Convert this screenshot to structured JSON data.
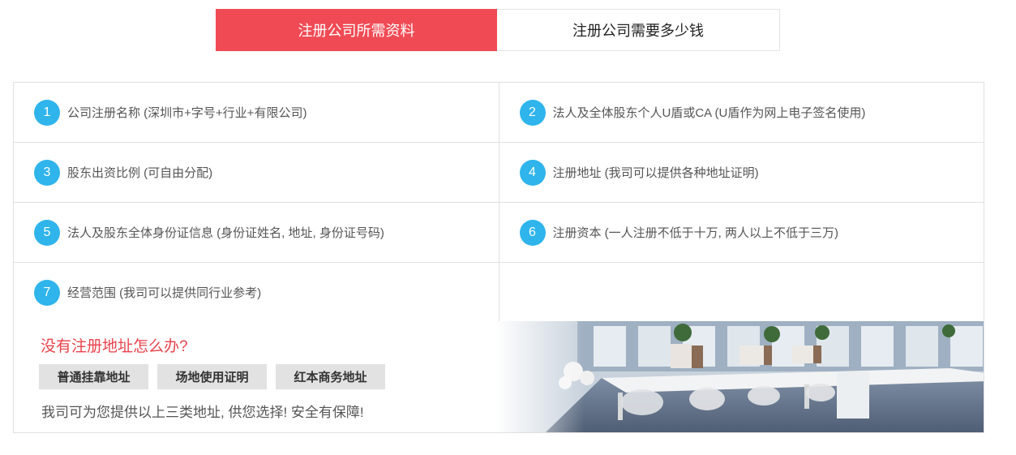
{
  "tabs": [
    {
      "label": "注册公司所需资料",
      "active": true
    },
    {
      "label": "注册公司需要多少钱",
      "active": false
    }
  ],
  "items": [
    {
      "num": "1",
      "text": "公司注册名称 (深圳市+字号+行业+有限公司)"
    },
    {
      "num": "2",
      "text": "法人及全体股东个人U盾或CA (U盾作为网上电子签名使用)"
    },
    {
      "num": "3",
      "text": "股东出资比例 (可自由分配)"
    },
    {
      "num": "4",
      "text": "注册地址 (我司可以提供各种地址证明)"
    },
    {
      "num": "5",
      "text": "法人及股东全体身份证信息 (身份证姓名, 地址, 身份证号码)"
    },
    {
      "num": "6",
      "text": "注册资本 (一人注册不低于十万, 两人以上不低于三万)"
    },
    {
      "num": "7",
      "text": "经营范围 (我司可以提供同行业参考)"
    }
  ],
  "banner": {
    "title": "没有注册地址怎么办?",
    "tags": [
      "普通挂靠地址",
      "场地使用证明",
      "红本商务地址"
    ],
    "desc": "我司可为您提供以上三类地址, 供您选择! 安全有保障!"
  },
  "colors": {
    "accent": "#f04b55",
    "number_badge": "#2fb4ec",
    "title_red": "#e9434c"
  }
}
